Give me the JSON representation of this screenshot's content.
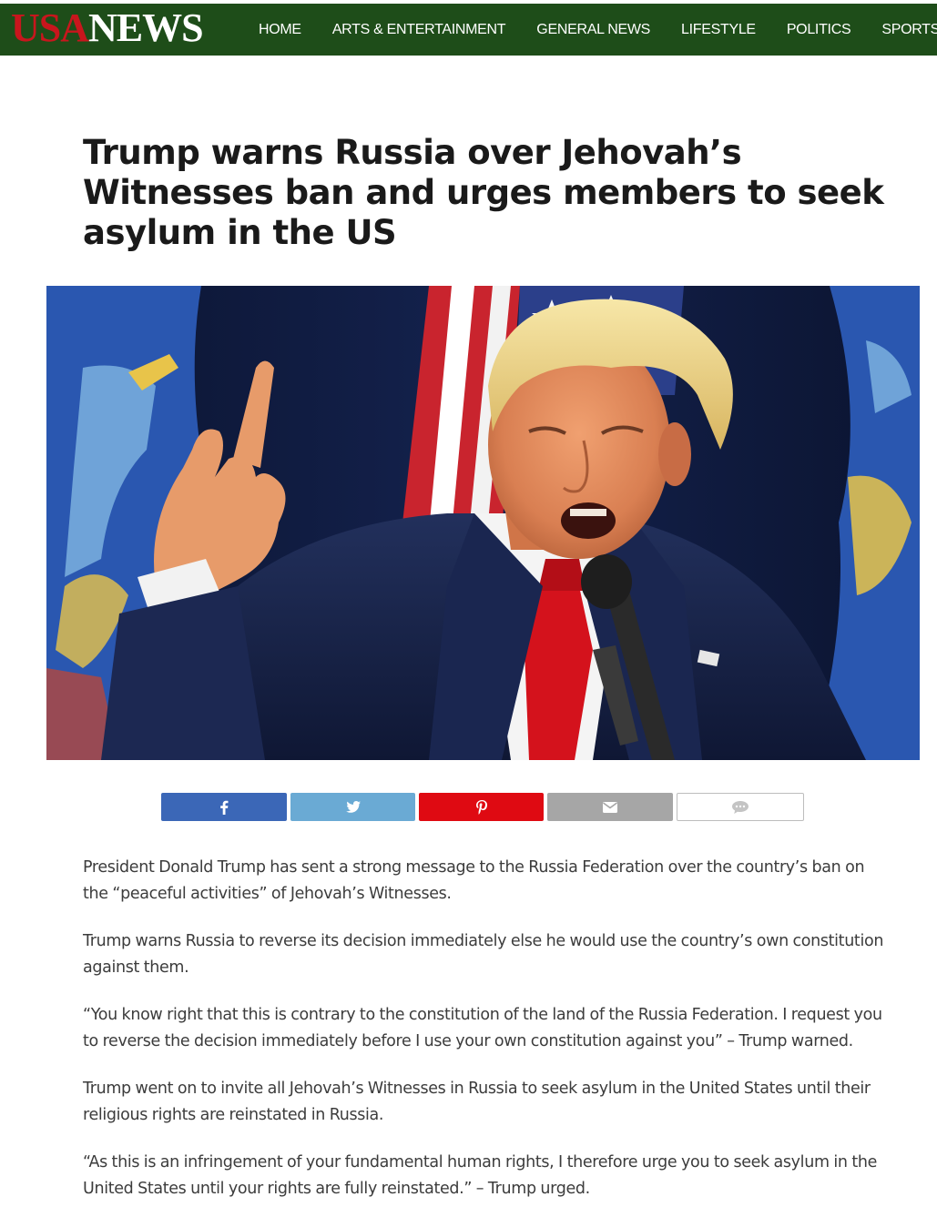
{
  "header": {
    "logo_usa": "USA",
    "logo_news": "NEWS",
    "nav": [
      {
        "label": "HOME"
      },
      {
        "label": "ARTS & ENTERTAINMENT"
      },
      {
        "label": "GENERAL NEWS"
      },
      {
        "label": "LIFESTYLE"
      },
      {
        "label": "POLITICS"
      },
      {
        "label": "SPORTS"
      }
    ]
  },
  "article": {
    "title": "Trump warns Russia over Jehovah’s Witnesses ban and urges members to seek asylum in the US",
    "paragraphs": [
      "President Donald Trump has sent a strong message to the Russia Federation over the country’s ban on the “peaceful activities” of Jehovah’s Witnesses.",
      "Trump warns Russia to reverse its decision immediately else he would use the country’s own constitution against them.",
      "“You know right that this is contrary to the constitution of the land of the Russia Federation. I request you to reverse the decision immediately before I use your own constitution against you” – Trump warned.",
      "Trump went on to invite all Jehovah’s Witnesses in Russia to seek asylum in the United States until their religious rights are reinstated in Russia.",
      "“As this is an infringement of your fundamental human rights, I therefore urge you to seek asylum in the United States until your rights are fully reinstated.” – Trump urged."
    ]
  },
  "share": {
    "buttons": [
      {
        "icon": "facebook-icon",
        "color": "#3b67b7"
      },
      {
        "icon": "twitter-icon",
        "color": "#6aaad4"
      },
      {
        "icon": "pinterest-icon",
        "color": "#df0a12"
      },
      {
        "icon": "email-icon",
        "color": "#a6a6a6"
      },
      {
        "icon": "comment-icon",
        "color": "#ffffff"
      }
    ]
  },
  "colors": {
    "nav_background": "#1e4d19",
    "logo_red": "#c8161d",
    "title_text": "#1a1a1a",
    "body_text": "#3c3c3c"
  }
}
